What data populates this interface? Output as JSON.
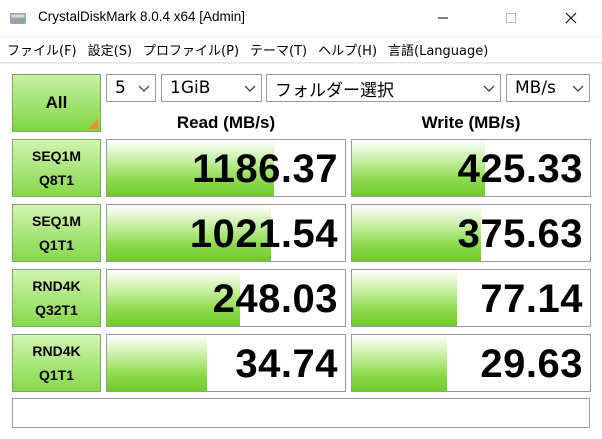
{
  "window": {
    "title": "CrystalDiskMark 8.0.4 x64 [Admin]"
  },
  "menu": [
    {
      "label": "ファイル(F)"
    },
    {
      "label": "設定(S)"
    },
    {
      "label": "プロファイル(P)"
    },
    {
      "label": "テーマ(T)"
    },
    {
      "label": "ヘルプ(H)"
    },
    {
      "label": "言語(Language)"
    }
  ],
  "controls": {
    "all_label": "All",
    "count": "5",
    "size": "1GiB",
    "folder": "フォルダー選択",
    "unit": "MB/s"
  },
  "headers": {
    "read": "Read (MB/s)",
    "write": "Write (MB/s)"
  },
  "tests": [
    {
      "line1": "SEQ1M",
      "line2": "Q8T1",
      "read": "1186.37",
      "write": "425.33",
      "read_fill": 0.7,
      "write_fill": 0.56
    },
    {
      "line1": "SEQ1M",
      "line2": "Q1T1",
      "read": "1021.54",
      "write": "375.63",
      "read_fill": 0.69,
      "write_fill": 0.54
    },
    {
      "line1": "RND4K",
      "line2": "Q32T1",
      "read": "248.03",
      "write": "77.14",
      "read_fill": 0.56,
      "write_fill": 0.44
    },
    {
      "line1": "RND4K",
      "line2": "Q1T1",
      "read": "34.74",
      "write": "29.63",
      "read_fill": 0.42,
      "write_fill": 0.4
    }
  ],
  "comment": "",
  "colors": {
    "accent_green": "#7ed640",
    "corner_orange": "#f08c2a"
  }
}
